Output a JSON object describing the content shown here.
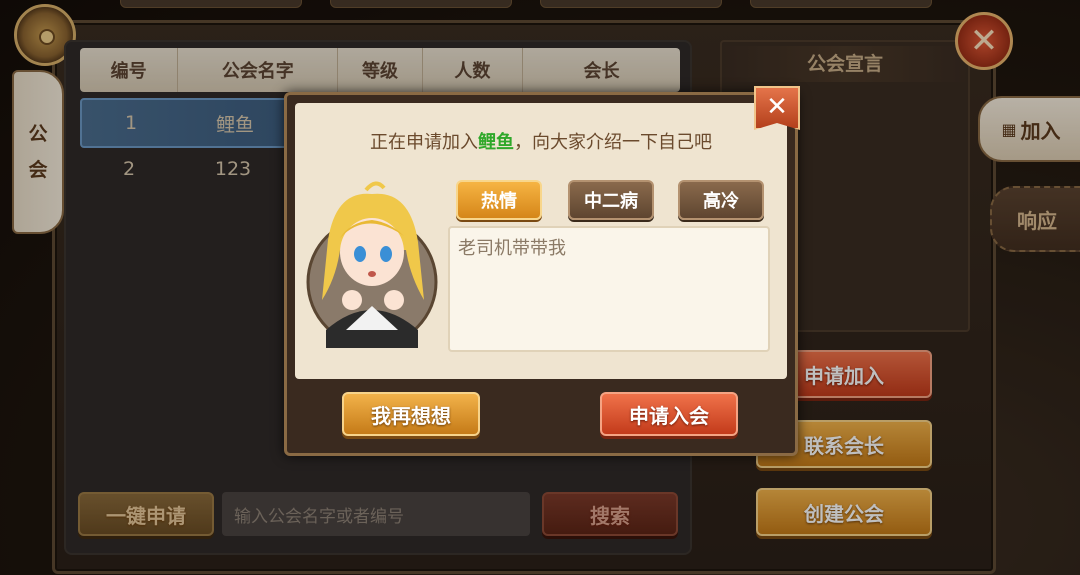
{
  "sidebar": {
    "tab_label_1": "公",
    "tab_label_2": "会"
  },
  "table": {
    "headers": [
      "编号",
      "公会名字",
      "等级",
      "人数",
      "会长"
    ],
    "rows": [
      {
        "id": "1",
        "name": "鲤鱼",
        "selected": true
      },
      {
        "id": "2",
        "name": "123",
        "selected": false
      }
    ]
  },
  "bottom": {
    "quick_apply_label": "一键申请",
    "search_placeholder": "输入公会名字或者编号",
    "search_button_label": "搜索"
  },
  "right_panel": {
    "title": "公会宣言",
    "tab_join": "加入",
    "tab_respond": "响应",
    "apply_join_label": "申请加入",
    "contact_leader_label": "联系会长",
    "create_guild_label": "创建公会"
  },
  "modal": {
    "prompt_prefix": "正在申请加入",
    "guild_name": "鲤鱼",
    "prompt_suffix": "，向大家介绍一下自己吧",
    "tags": [
      "热情",
      "中二病",
      "高冷"
    ],
    "intro_text": "老司机带带我",
    "cancel_label": "我再想想",
    "confirm_label": "申请入会",
    "close_glyph": "✕"
  },
  "close_glyph": "✕",
  "colors": {
    "highlight_green": "#2fa82a",
    "accent_gold": "#f2b24a",
    "accent_red": "#c33b1b"
  }
}
